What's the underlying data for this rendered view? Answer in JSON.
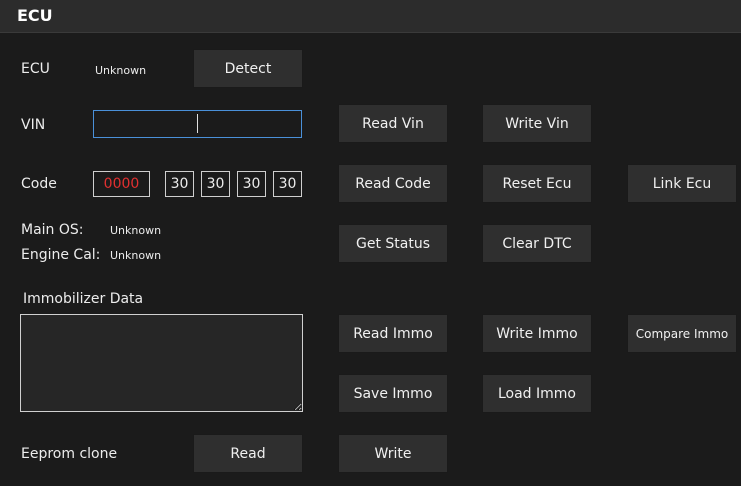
{
  "window": {
    "title": "ECU"
  },
  "ecu": {
    "label": "ECU",
    "value": "Unknown",
    "detect_button": "Detect"
  },
  "vin": {
    "label": "VIN",
    "value": "",
    "read_button": "Read Vin",
    "write_button": "Write Vin"
  },
  "code": {
    "label": "Code",
    "pin_value": "0000",
    "bytes": [
      "30",
      "30",
      "30",
      "30"
    ],
    "read_button": "Read Code",
    "reset_button": "Reset Ecu",
    "link_button": "Link Ecu"
  },
  "status": {
    "main_os_label": "Main OS:",
    "main_os_value": "Unknown",
    "engine_cal_label": "Engine Cal:",
    "engine_cal_value": "Unknown",
    "get_status_button": "Get Status",
    "clear_dtc_button": "Clear DTC"
  },
  "immobilizer": {
    "label": "Immobilizer Data",
    "value": "",
    "read_button": "Read Immo",
    "write_button": "Write Immo",
    "compare_button": "Compare Immo",
    "save_button": "Save Immo",
    "load_button": "Load Immo"
  },
  "eeprom": {
    "label": "Eeprom clone",
    "read_button": "Read",
    "write_button": "Write"
  },
  "colors": {
    "accent_border": "#4a90d9",
    "code_text": "#e23030",
    "background": "#1b1b1b"
  }
}
